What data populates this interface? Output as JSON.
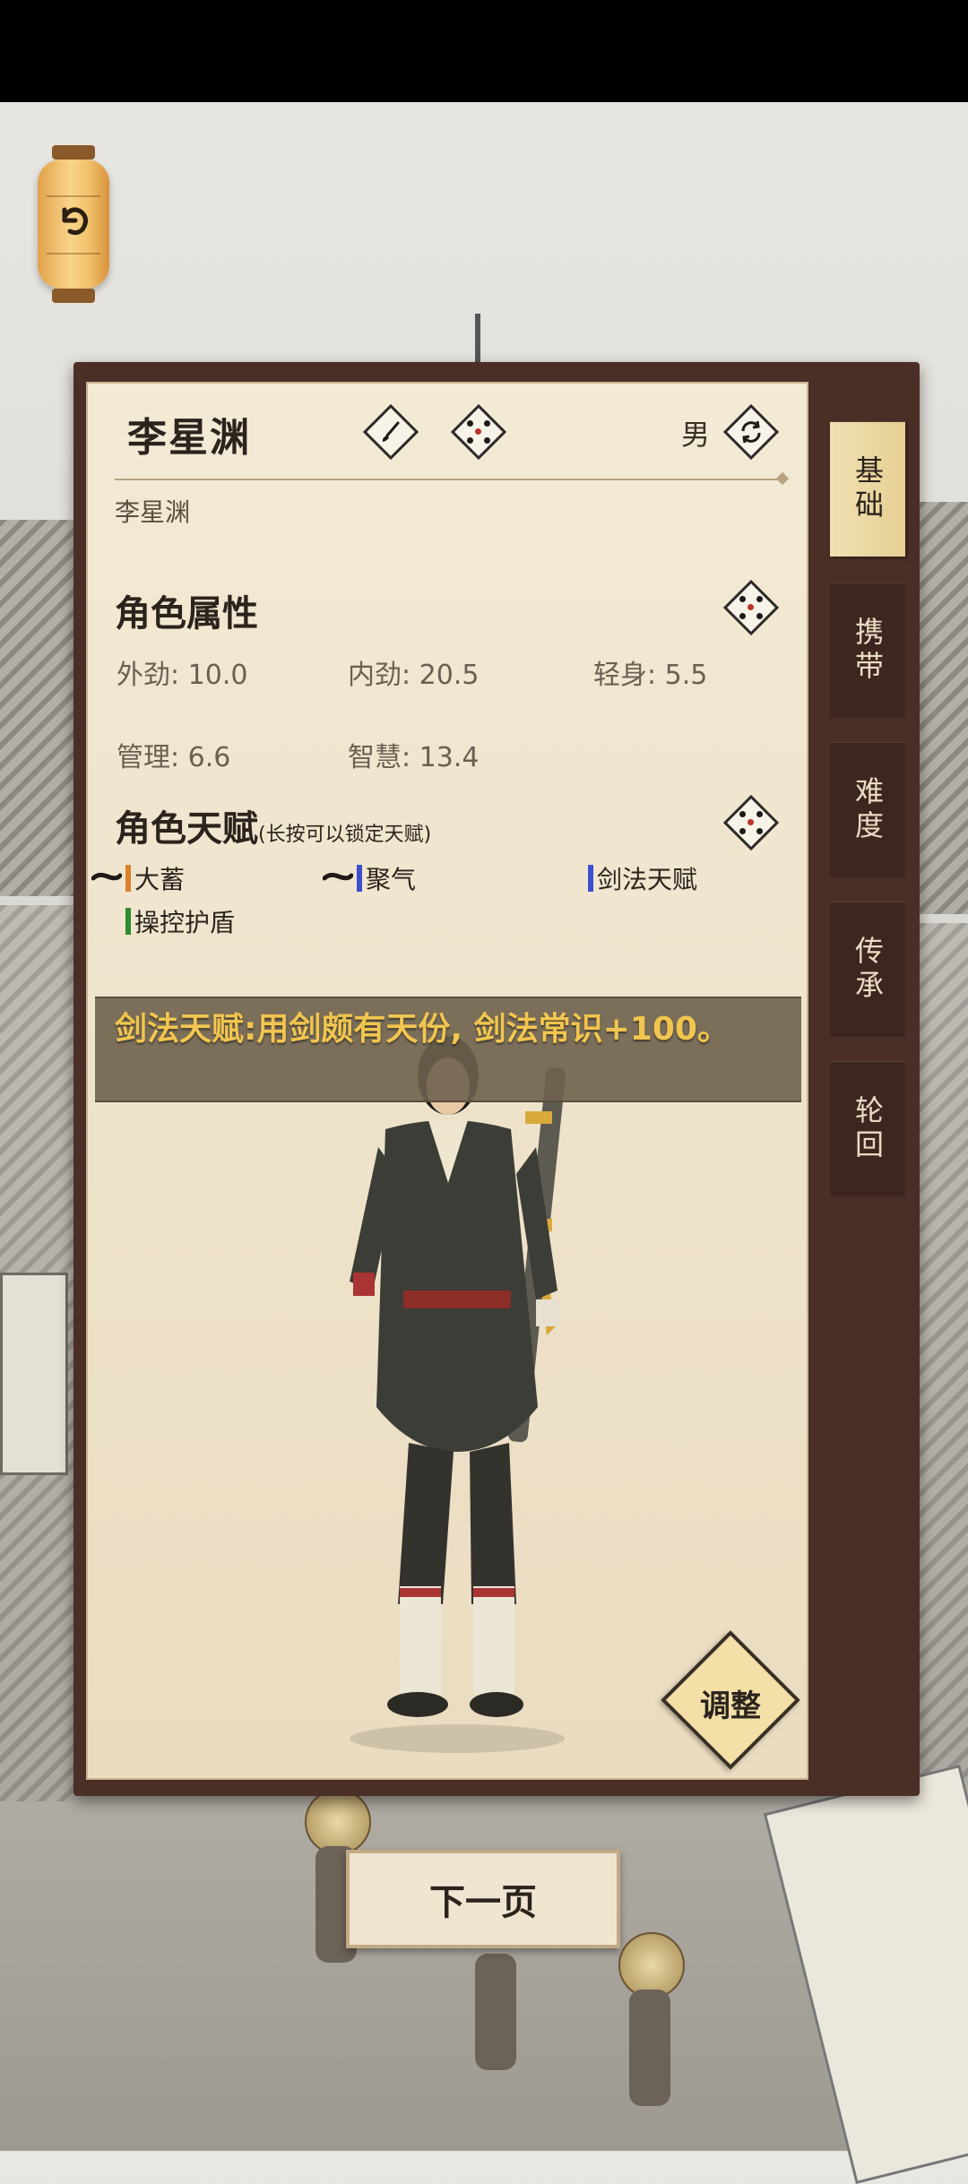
{
  "character": {
    "name": "李星渊",
    "subname": "李星渊",
    "gender": "男"
  },
  "attributes": {
    "title": "角色属性",
    "items": [
      {
        "label": "外劲: 10.0"
      },
      {
        "label": "内劲: 20.5"
      },
      {
        "label": "轻身: 5.5"
      },
      {
        "label": "管理: 6.6"
      },
      {
        "label": "智慧: 13.4"
      }
    ]
  },
  "talents": {
    "title": "角色天赋",
    "hint": "(长按可以锁定天赋)",
    "items": [
      {
        "label": "大蓄",
        "color": "#d9822b",
        "ink": true
      },
      {
        "label": "聚气",
        "color": "#3b4fd1",
        "ink": true
      },
      {
        "label": "剑法天赋",
        "color": "#3b4fd1",
        "ink": false
      },
      {
        "label": "操控护盾",
        "color": "#2e8b2e",
        "ink": false
      }
    ]
  },
  "tooltip": {
    "text": "剑法天赋:用剑颇有天份, 剑法常识+100。"
  },
  "tabs": [
    {
      "label": "基础",
      "active": true
    },
    {
      "label": "携带",
      "active": false
    },
    {
      "label": "难度",
      "active": false
    },
    {
      "label": "传承",
      "active": false
    },
    {
      "label": "轮回",
      "active": false
    }
  ],
  "buttons": {
    "adjust": "调整",
    "next_page": "下一页"
  },
  "icons": {
    "back": "back-arrow-icon",
    "rename": "brush-icon",
    "randomize": "dice-icon",
    "gender_switch": "refresh-icon"
  }
}
